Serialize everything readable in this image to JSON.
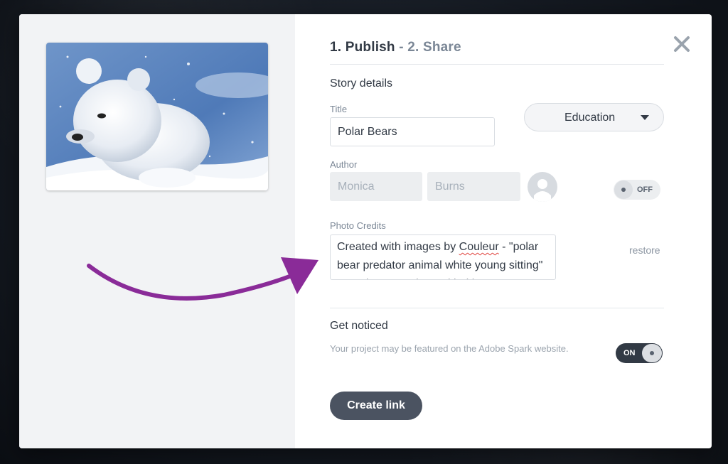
{
  "steps": {
    "step1": "1. Publish",
    "separator": " - ",
    "step2": "2. Share"
  },
  "story_details": {
    "heading": "Story details",
    "title_label": "Title",
    "title_value": "Polar Bears",
    "category_selected": "Education",
    "author_label": "Author",
    "author_first_placeholder": "Monica",
    "author_last_placeholder": "Burns",
    "author_toggle_label": "OFF",
    "author_toggle_on": false
  },
  "photo_credits": {
    "label": "Photo Credits",
    "text_before": "Created with images by ",
    "text_misspelled": "Couleur",
    "text_after": " - \"polar bear predator animal white young sitting\" - Matthew Moreia \"untitled image\"",
    "restore_label": "restore"
  },
  "get_noticed": {
    "heading": "Get noticed",
    "hint": "Your project may be featured on the Adobe Spark website.",
    "toggle_label": "ON",
    "toggle_on": true
  },
  "actions": {
    "create_link_label": "Create link"
  },
  "icons": {
    "close": "close-icon",
    "caret": "chevron-down-icon",
    "avatar": "user-avatar-icon",
    "arrow": "curved-arrow-annotation"
  },
  "colors": {
    "primary_dark": "#323a45",
    "muted": "#7b8796",
    "annotation_arrow": "#8a2b98",
    "button_bg": "#4b5361"
  }
}
